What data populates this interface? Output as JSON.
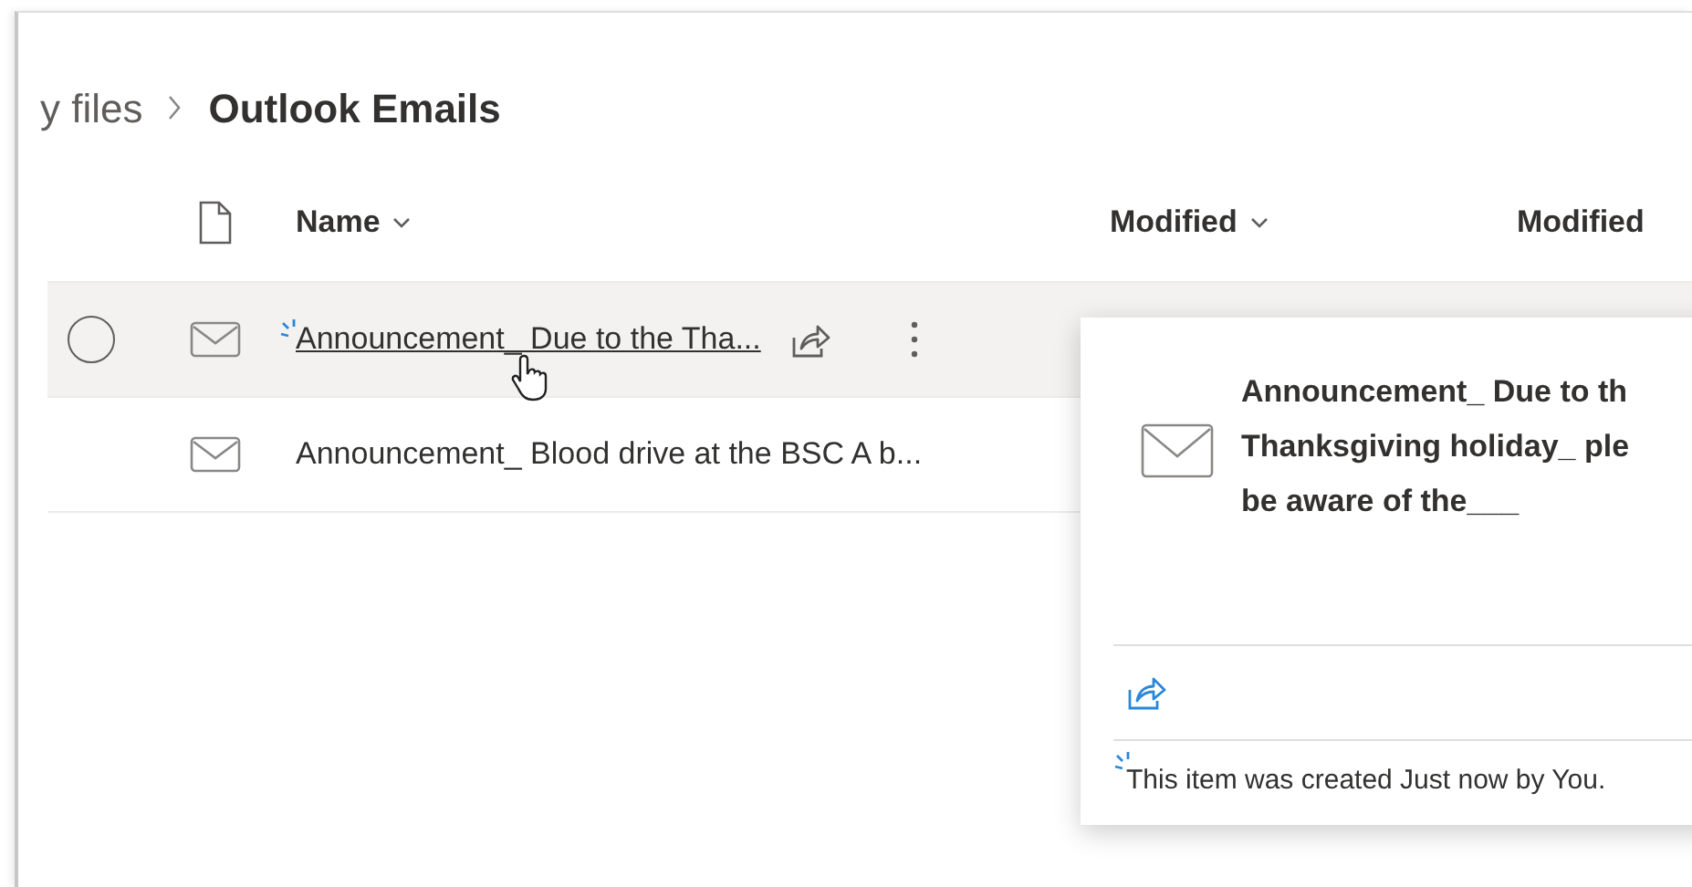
{
  "breadcrumb": [
    {
      "label": "y files",
      "current": false
    },
    {
      "label": "Outlook Emails",
      "current": true
    }
  ],
  "columns": [
    {
      "label": "Name",
      "sortable": true
    },
    {
      "label": "Modified",
      "sortable": true
    },
    {
      "label": "Modified",
      "sortable": false
    }
  ],
  "rows": [
    {
      "name": "Announcement_ Due to the Tha...",
      "hovered": true,
      "new": true
    },
    {
      "name": "Announcement_ Blood drive at the BSC A b...",
      "hovered": false,
      "new": false
    }
  ],
  "preview": {
    "title_lines": [
      "Announcement_ Due to th",
      "Thanksgiving holiday_ ple",
      "be aware of the___"
    ],
    "footer": "This item was created Just now by You.",
    "new": true
  }
}
